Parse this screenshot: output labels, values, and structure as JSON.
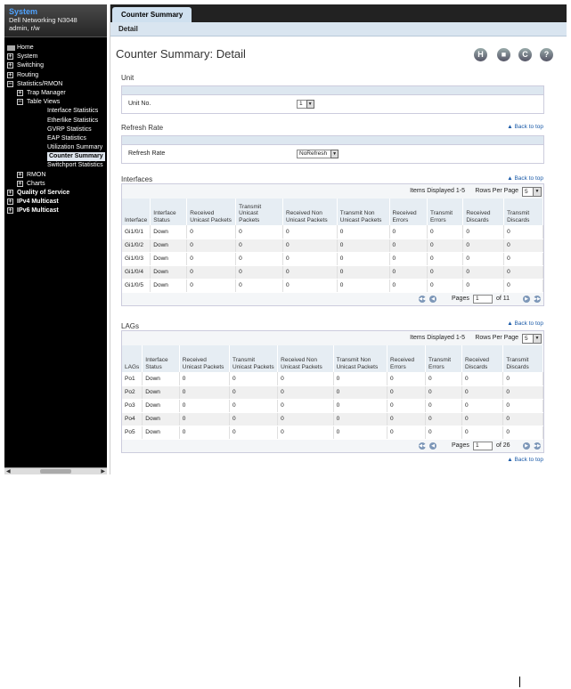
{
  "sidebar": {
    "title": "System",
    "device": "Dell Networking N3048",
    "user": "admin, r/w",
    "items": [
      {
        "label": "Home",
        "depth": 0,
        "icon": "home"
      },
      {
        "label": "System",
        "depth": 0,
        "icon": "plus"
      },
      {
        "label": "Switching",
        "depth": 0,
        "icon": "plus"
      },
      {
        "label": "Routing",
        "depth": 0,
        "icon": "plus"
      },
      {
        "label": "Statistics/RMON",
        "depth": 0,
        "icon": "minus"
      },
      {
        "label": "Trap Manager",
        "depth": 1,
        "icon": "plus"
      },
      {
        "label": "Table Views",
        "depth": 1,
        "icon": "minus"
      },
      {
        "label": "Interface Statistics",
        "depth": 2
      },
      {
        "label": "Etherlike Statistics",
        "depth": 2
      },
      {
        "label": "GVRP Statistics",
        "depth": 2
      },
      {
        "label": "EAP Statistics",
        "depth": 2
      },
      {
        "label": "Utilization Summary",
        "depth": 2
      },
      {
        "label": "Counter Summary",
        "depth": 2,
        "selected": true
      },
      {
        "label": "Switchport Statistics",
        "depth": 2
      },
      {
        "label": "RMON",
        "depth": 1,
        "icon": "plus"
      },
      {
        "label": "Charts",
        "depth": 1,
        "icon": "plus"
      },
      {
        "label": "Quality of Service",
        "depth": 0,
        "icon": "plus"
      },
      {
        "label": "IPv4 Multicast",
        "depth": 0,
        "icon": "plus"
      },
      {
        "label": "IPv6 Multicast",
        "depth": 0,
        "icon": "plus"
      }
    ]
  },
  "tabs": {
    "active": "Counter Summary",
    "sub": "Detail"
  },
  "page": {
    "title": "Counter Summary: Detail"
  },
  "toolbar": {
    "icons": [
      "save-icon",
      "print-icon",
      "refresh-icon",
      "help-icon"
    ],
    "glyphs": [
      "H",
      "■",
      "C",
      "?"
    ]
  },
  "back_to_top": "Back to top",
  "unit": {
    "section": "Unit",
    "label": "Unit No.",
    "value": "1"
  },
  "refresh": {
    "section": "Refresh Rate",
    "label": "Refresh Rate",
    "value": "NoRefresh"
  },
  "interfaces": {
    "section": "Interfaces",
    "items_displayed": "Items Displayed 1-5",
    "rows_per_page_label": "Rows Per Page",
    "rows_per_page": "5",
    "columns": [
      "Interface",
      "Interface Status",
      "Received Unicast Packets",
      "Transmit Unicast Packets",
      "Received Non Unicast Packets",
      "Transmit Non Unicast Packets",
      "Received Errors",
      "Transmit Errors",
      "Received Discards",
      "Transmit Discards"
    ],
    "rows": [
      [
        "Gi1/0/1",
        "Down",
        "0",
        "0",
        "0",
        "0",
        "0",
        "0",
        "0",
        "0"
      ],
      [
        "Gi1/0/2",
        "Down",
        "0",
        "0",
        "0",
        "0",
        "0",
        "0",
        "0",
        "0"
      ],
      [
        "Gi1/0/3",
        "Down",
        "0",
        "0",
        "0",
        "0",
        "0",
        "0",
        "0",
        "0"
      ],
      [
        "Gi1/0/4",
        "Down",
        "0",
        "0",
        "0",
        "0",
        "0",
        "0",
        "0",
        "0"
      ],
      [
        "Gi1/0/5",
        "Down",
        "0",
        "0",
        "0",
        "0",
        "0",
        "0",
        "0",
        "0"
      ]
    ],
    "pages_label": "Pages",
    "page": "1",
    "of": "of 11"
  },
  "lags": {
    "section": "LAGs",
    "items_displayed": "Items Displayed 1-5",
    "rows_per_page_label": "Rows Per Page",
    "rows_per_page": "5",
    "columns": [
      "LAGs",
      "Interface Status",
      "Received Unicast Packets",
      "Transmit Unicast Packets",
      "Received Non Unicast Packets",
      "Transmit Non Unicast Packets",
      "Received Errors",
      "Transmit Errors",
      "Received Discards",
      "Transmit Discards"
    ],
    "rows": [
      [
        "Po1",
        "Down",
        "0",
        "0",
        "0",
        "0",
        "0",
        "0",
        "0",
        "0"
      ],
      [
        "Po2",
        "Down",
        "0",
        "0",
        "0",
        "0",
        "0",
        "0",
        "0",
        "0"
      ],
      [
        "Po3",
        "Down",
        "0",
        "0",
        "0",
        "0",
        "0",
        "0",
        "0",
        "0"
      ],
      [
        "Po4",
        "Down",
        "0",
        "0",
        "0",
        "0",
        "0",
        "0",
        "0",
        "0"
      ],
      [
        "Po5",
        "Down",
        "0",
        "0",
        "0",
        "0",
        "0",
        "0",
        "0",
        "0"
      ]
    ],
    "pages_label": "Pages",
    "page": "1",
    "of": "of 26"
  }
}
